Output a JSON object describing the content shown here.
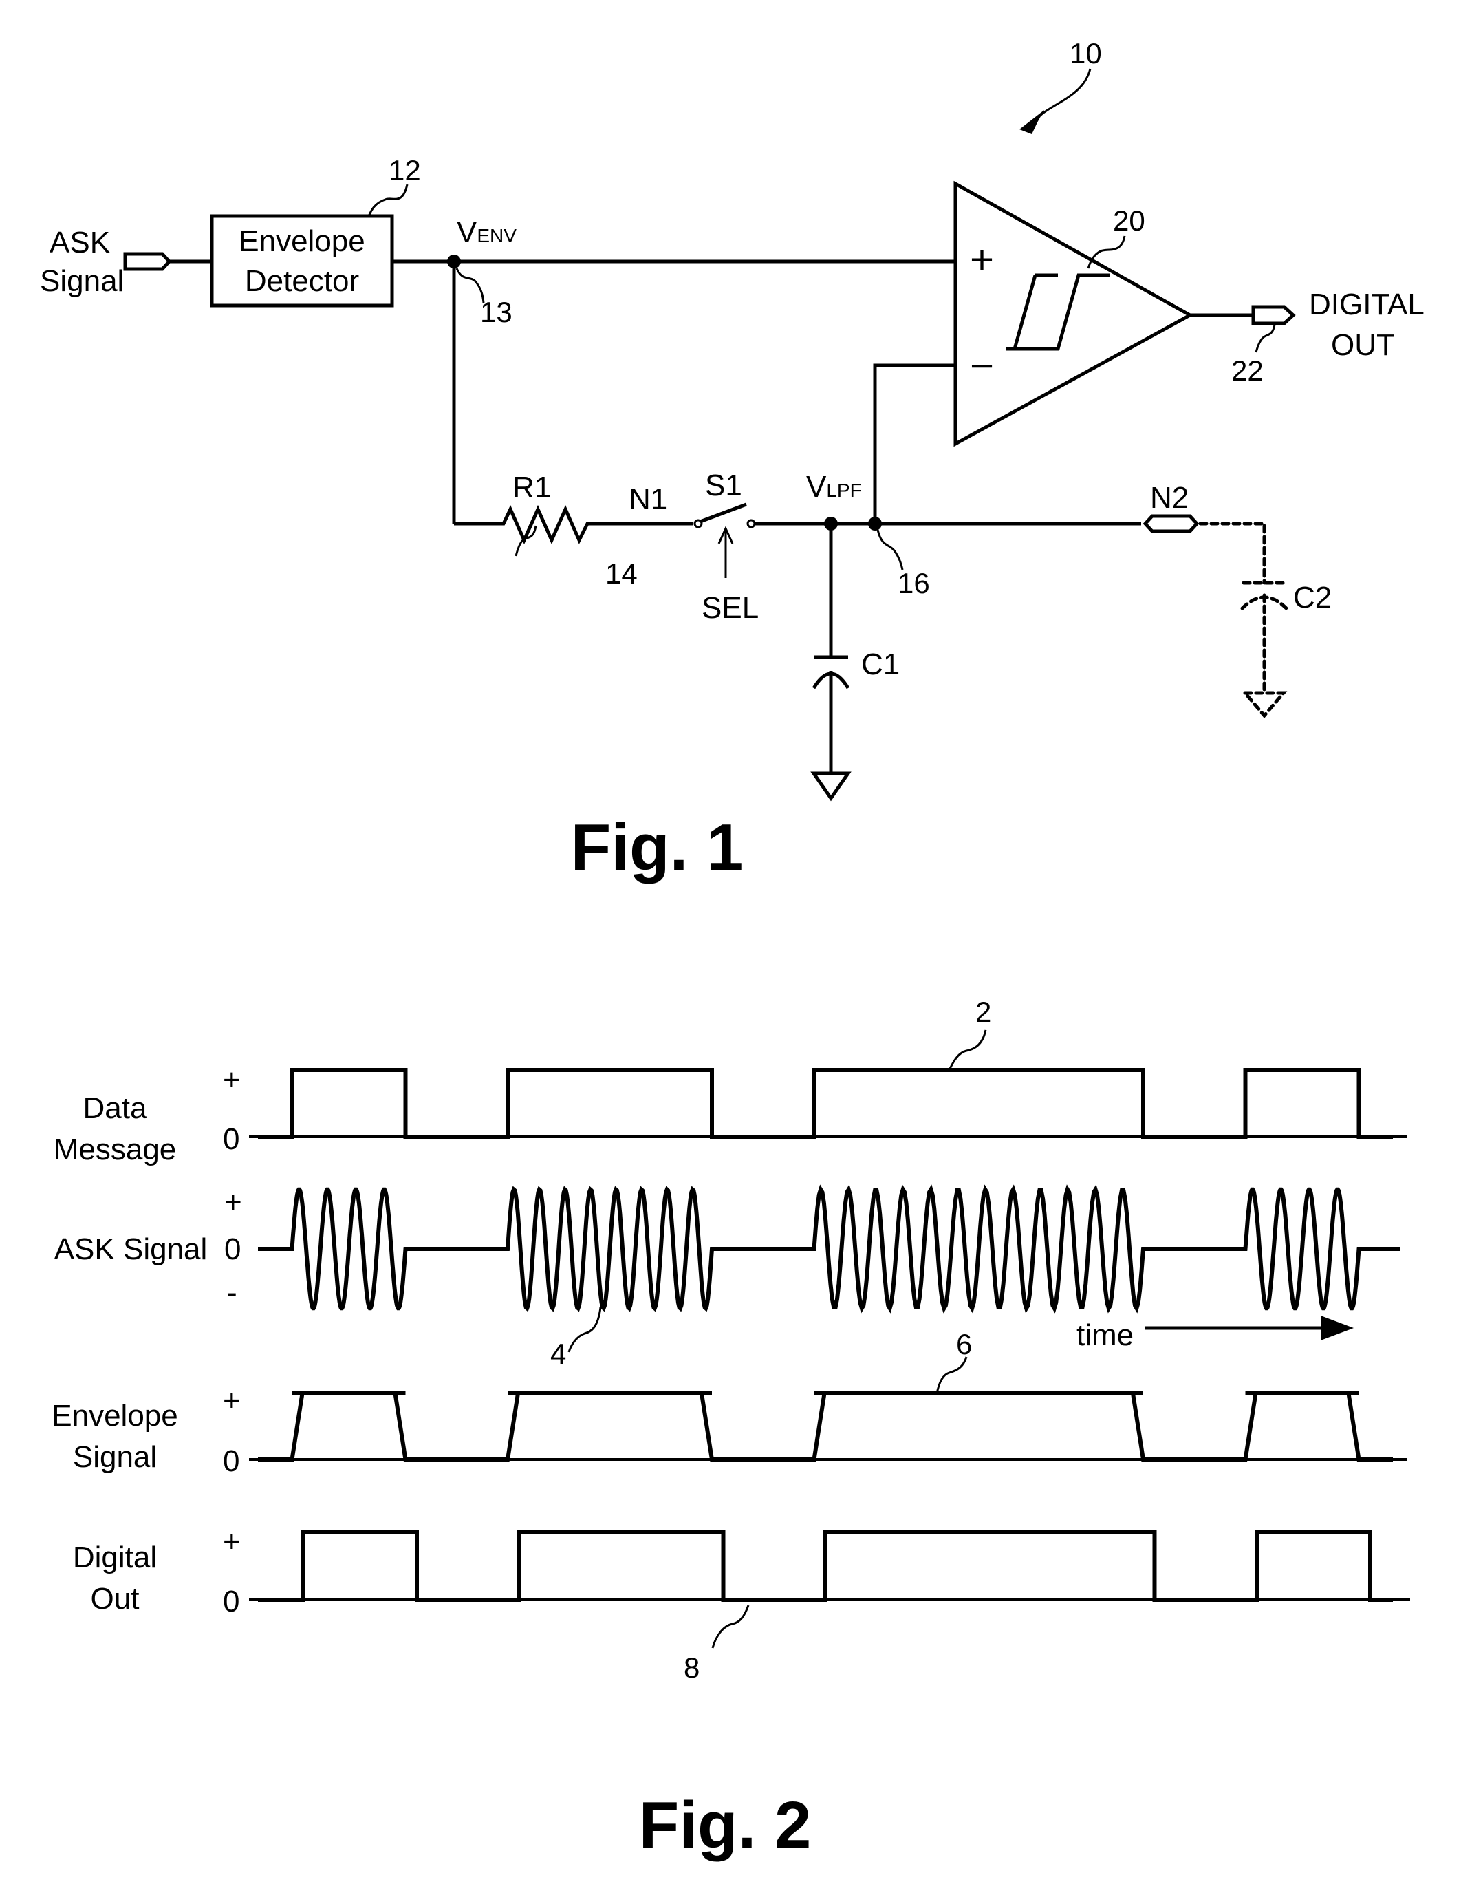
{
  "fig1": {
    "reference_numeral": "10",
    "input": {
      "label_line1": "ASK",
      "label_line2": "Signal"
    },
    "envelope_detector": {
      "label_line1": "Envelope",
      "label_line2": "Detector",
      "ref": "12"
    },
    "node_venv": {
      "label_main": "V",
      "label_sub": "ENV",
      "ref": "13"
    },
    "comparator": {
      "ref": "20",
      "plus_symbol": "+",
      "minus_symbol": "−"
    },
    "output": {
      "label_line1": "DIGITAL",
      "label_line2": "OUT",
      "ref": "22"
    },
    "resistor": {
      "label": "R1"
    },
    "node_n1": {
      "label": "N1",
      "ref": "14"
    },
    "switch": {
      "label": "S1",
      "control_label": "SEL"
    },
    "node_vlpf": {
      "label_main": "V",
      "label_sub": "LPF",
      "ref": "16"
    },
    "capacitor_c1": {
      "label": "C1"
    },
    "node_n2": {
      "label": "N2"
    },
    "capacitor_c2": {
      "label": "C2",
      "optional": true
    },
    "caption": "Fig. 1"
  },
  "fig2": {
    "caption": "Fig. 2",
    "time_label": "time",
    "tick_plus": "+",
    "tick_zero": "0",
    "tick_minus": "-",
    "traces": [
      {
        "name": "data-message",
        "label_line1": "Data",
        "label_line2": "Message",
        "ref": "2"
      },
      {
        "name": "ask-signal",
        "label_line1": "ASK Signal",
        "label_line2": "",
        "ref": "4"
      },
      {
        "name": "envelope-signal",
        "label_line1": "Envelope",
        "label_line2": "Signal",
        "ref": "6"
      },
      {
        "name": "digital-out",
        "label_line1": "Digital",
        "label_line2": "Out",
        "ref": "8"
      }
    ]
  },
  "chart_data": {
    "type": "line",
    "title": "Fig. 2",
    "xlabel": "time",
    "ylabel": "",
    "series": [
      {
        "name": "Data Message",
        "kind": "square",
        "levels": [
          "0",
          "+"
        ],
        "high_intervals": [
          [
            0.03,
            0.13
          ],
          [
            0.22,
            0.4
          ],
          [
            0.49,
            0.78
          ],
          [
            0.87,
            0.97
          ]
        ]
      },
      {
        "name": "ASK Signal",
        "kind": "ask-burst",
        "levels": [
          "-",
          "0",
          "+"
        ],
        "bursts": [
          {
            "start": 0.03,
            "end": 0.13,
            "cycles": 4
          },
          {
            "start": 0.22,
            "end": 0.4,
            "cycles": 8
          },
          {
            "start": 0.49,
            "end": 0.78,
            "cycles": 12
          },
          {
            "start": 0.87,
            "end": 0.97,
            "cycles": 4
          }
        ]
      },
      {
        "name": "Envelope Signal",
        "kind": "trapezoid",
        "levels": [
          "0",
          "+"
        ],
        "high_intervals": [
          [
            0.03,
            0.13
          ],
          [
            0.22,
            0.4
          ],
          [
            0.49,
            0.78
          ],
          [
            0.87,
            0.97
          ]
        ]
      },
      {
        "name": "Digital Out",
        "kind": "square",
        "levels": [
          "0",
          "+"
        ],
        "high_intervals": [
          [
            0.04,
            0.14
          ],
          [
            0.23,
            0.41
          ],
          [
            0.5,
            0.79
          ],
          [
            0.88,
            0.98
          ]
        ]
      }
    ]
  }
}
